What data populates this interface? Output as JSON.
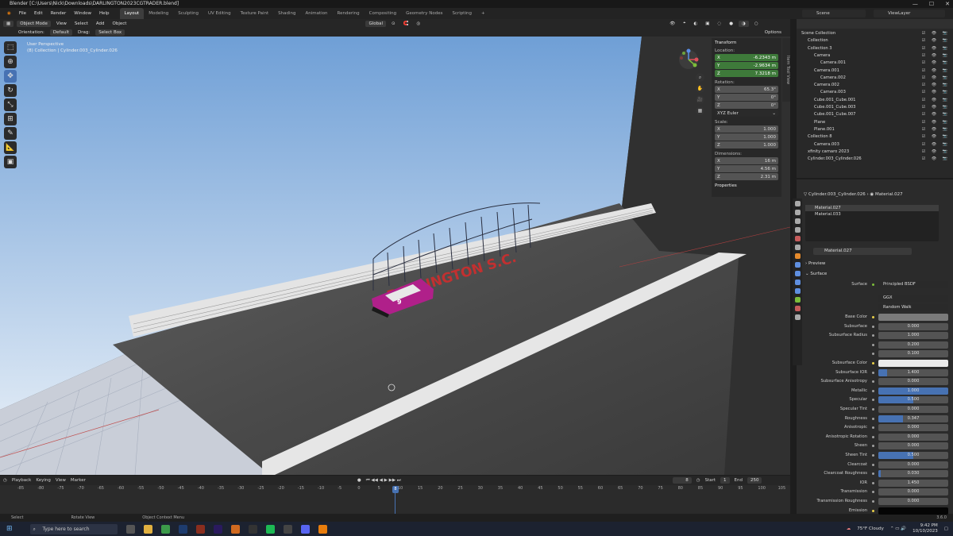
{
  "window": {
    "title": "Blender [C:\\Users\\Nick\\Downloads\\DARLINGTON2023CGTRADER.blend]"
  },
  "menus": [
    "File",
    "Edit",
    "Render",
    "Window",
    "Help"
  ],
  "workspaces": [
    "Layout",
    "Modeling",
    "Sculpting",
    "UV Editing",
    "Texture Paint",
    "Shading",
    "Animation",
    "Rendering",
    "Compositing",
    "Geometry Nodes",
    "Scripting"
  ],
  "active_workspace": "Layout",
  "scene": "Scene",
  "view_layer": "ViewLayer",
  "viewport_header": {
    "mode": "Object Mode",
    "menus": [
      "View",
      "Select",
      "Add",
      "Object"
    ],
    "transform_orientation": "Global",
    "orientation_label": "Orientation:",
    "orientation_value": "Default",
    "drag_label": "Drag:",
    "drag_value": "Select Box",
    "options": "Options"
  },
  "viewport_info": {
    "line1": "User Perspective",
    "line2": "(8) Collection | Cylinder.003_Cylinder.026"
  },
  "scene_text": "DARLINGTON S.C.",
  "npanel": {
    "section": "Transform",
    "location_label": "Location:",
    "location": [
      "-6.2343 m",
      "-2.9634 m",
      "7.3218 m"
    ],
    "rotation_label": "Rotation:",
    "rotation": [
      "65.3°",
      "0°",
      "0°"
    ],
    "rotation_mode": "XYZ Euler",
    "scale_label": "Scale:",
    "scale": [
      "1.000",
      "1.000",
      "1.000"
    ],
    "dimensions_label": "Dimensions:",
    "dimensions": [
      "16 m",
      "4.56 m",
      "2.31 m"
    ],
    "axes": [
      "X",
      "Y",
      "Z"
    ],
    "properties": "Properties",
    "tabs": "Item  Tool  View"
  },
  "timeline": {
    "menus": [
      "Playback",
      "Keying",
      "View",
      "Marker"
    ],
    "current_frame": "8",
    "start_label": "Start",
    "start": "1",
    "end_label": "End",
    "end": "250",
    "ticks": [
      "-85",
      "-80",
      "-75",
      "-70",
      "-65",
      "-60",
      "-55",
      "-50",
      "-45",
      "-40",
      "-35",
      "-30",
      "-25",
      "-20",
      "-15",
      "-10",
      "-5",
      "0",
      "5",
      "10",
      "15",
      "20",
      "25",
      "30",
      "35",
      "40",
      "45",
      "50",
      "55",
      "60",
      "65",
      "70",
      "75",
      "80",
      "85",
      "90",
      "95",
      "100",
      "105"
    ]
  },
  "statusbar": {
    "select": "Select",
    "rotate": "Rotate View",
    "context": "Object Context Menu",
    "version": "3.6.0"
  },
  "taskbar": {
    "search_placeholder": "Type here to search",
    "weather": "75°F  Cloudy",
    "time": "9:42 PM",
    "date": "10/10/2023"
  },
  "outliner": {
    "rows": [
      {
        "label": "Scene Collection",
        "indent": 0
      },
      {
        "label": "Collection",
        "indent": 1
      },
      {
        "label": "Collection 3",
        "indent": 1
      },
      {
        "label": "Camera",
        "indent": 2
      },
      {
        "label": "Camera.001",
        "indent": 3
      },
      {
        "label": "Camera.001",
        "indent": 2
      },
      {
        "label": "Camera.002",
        "indent": 3
      },
      {
        "label": "Camera.002",
        "indent": 2
      },
      {
        "label": "Camera.003",
        "indent": 3
      },
      {
        "label": "Cube.001_Cube.001",
        "indent": 2
      },
      {
        "label": "Cube.001_Cube.003",
        "indent": 2
      },
      {
        "label": "Cube.001_Cube.007",
        "indent": 2
      },
      {
        "label": "Plane",
        "indent": 2
      },
      {
        "label": "Plane.001",
        "indent": 2
      },
      {
        "label": "Collection 8",
        "indent": 1
      },
      {
        "label": "Camera.003",
        "indent": 2
      },
      {
        "label": "xfinity camaro 2023",
        "indent": 1
      },
      {
        "label": "Cylinder.003_Cylinder.026",
        "indent": 1
      }
    ]
  },
  "properties": {
    "breadcrumb_object": "Cylinder.003_Cylinder.026",
    "breadcrumb_material": "Material.027",
    "slots": [
      "Material.027",
      "Material.033"
    ],
    "material_name": "Material.027",
    "preview": "Preview",
    "surface": "Surface",
    "surface_label": "Surface",
    "surface_value": "Principled BSDF",
    "dist1": "GGX",
    "dist2": "Random Walk",
    "rows": [
      {
        "label": "Base Color",
        "value": "",
        "kind": "gray"
      },
      {
        "label": "Subsurface",
        "value": "0.000",
        "kind": "num",
        "fill": 0
      },
      {
        "label": "Subsurface Radius",
        "value": "1.000",
        "kind": "num",
        "fill": 0
      },
      {
        "label": "",
        "value": "0.200",
        "kind": "num",
        "fill": 0
      },
      {
        "label": "",
        "value": "0.100",
        "kind": "num",
        "fill": 0
      },
      {
        "label": "Subsurface Color",
        "value": "",
        "kind": "white"
      },
      {
        "label": "Subsurface IOR",
        "value": "1.400",
        "kind": "num",
        "fill": 0.13
      },
      {
        "label": "Subsurface Anisotropy",
        "value": "0.000",
        "kind": "num",
        "fill": 0
      },
      {
        "label": "Metallic",
        "value": "1.000",
        "kind": "num",
        "fill": 1
      },
      {
        "label": "Specular",
        "value": "0.500",
        "kind": "num",
        "fill": 0.5
      },
      {
        "label": "Specular Tint",
        "value": "0.000",
        "kind": "num",
        "fill": 0
      },
      {
        "label": "Roughness",
        "value": "0.347",
        "kind": "num",
        "fill": 0.347
      },
      {
        "label": "Anisotropic",
        "value": "0.000",
        "kind": "num",
        "fill": 0
      },
      {
        "label": "Anisotropic Rotation",
        "value": "0.000",
        "kind": "num",
        "fill": 0
      },
      {
        "label": "Sheen",
        "value": "0.000",
        "kind": "num",
        "fill": 0
      },
      {
        "label": "Sheen Tint",
        "value": "0.500",
        "kind": "num",
        "fill": 0.5
      },
      {
        "label": "Clearcoat",
        "value": "0.000",
        "kind": "num",
        "fill": 0
      },
      {
        "label": "Clearcoat Roughness",
        "value": "0.030",
        "kind": "num",
        "fill": 0.03
      },
      {
        "label": "IOR",
        "value": "1.450",
        "kind": "num",
        "fill": 0
      },
      {
        "label": "Transmission",
        "value": "0.000",
        "kind": "num",
        "fill": 0
      },
      {
        "label": "Transmission Roughness",
        "value": "0.000",
        "kind": "num",
        "fill": 0
      },
      {
        "label": "Emission",
        "value": "",
        "kind": "black"
      }
    ]
  },
  "colors": {
    "accent": "#4772b3",
    "location_field": "#3e7a3a"
  }
}
